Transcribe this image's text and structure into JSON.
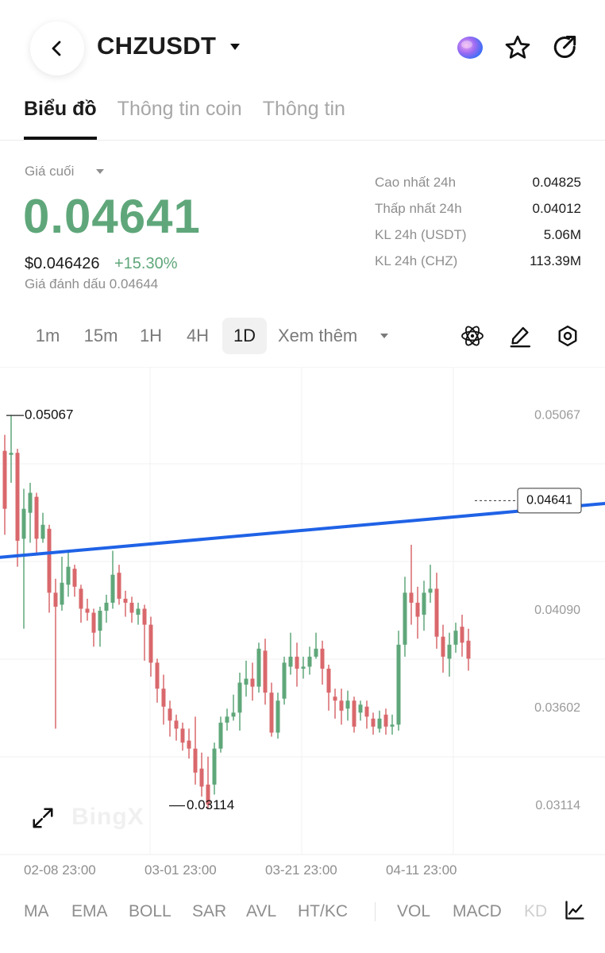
{
  "header": {
    "title": "CHZUSDT",
    "icons": [
      "back-icon",
      "caret-down-icon",
      "ai-orb-icon",
      "star-icon",
      "share-icon"
    ]
  },
  "tabs": [
    {
      "label": "Biểu đồ",
      "active": true
    },
    {
      "label": "Thông tin coin",
      "active": false
    },
    {
      "label": "Thông tin",
      "active": false
    }
  ],
  "price": {
    "label": "Giá cuối",
    "last": "0.04641",
    "usd": "$0.046426",
    "change": "+15.30%",
    "mark": "Giá đánh dấu 0.04644",
    "color_up": "#5fa77a"
  },
  "stats": [
    {
      "label": "Cao nhất 24h",
      "value": "0.04825"
    },
    {
      "label": "Thấp nhất 24h",
      "value": "0.04012"
    },
    {
      "label": "KL 24h (USDT)",
      "value": "5.06M"
    },
    {
      "label": "KL 24h (CHZ)",
      "value": "113.39M"
    }
  ],
  "timeframes": [
    {
      "label": "1m",
      "active": false
    },
    {
      "label": "15m",
      "active": false
    },
    {
      "label": "1H",
      "active": false
    },
    {
      "label": "4H",
      "active": false
    },
    {
      "label": "1D",
      "active": true
    }
  ],
  "more_label": "Xem thêm",
  "tools": [
    "atom-icon",
    "pencil-icon",
    "settings-icon"
  ],
  "watermark": "BingX",
  "chart_data": {
    "type": "candlestick",
    "y_ticks": [
      "0.05067",
      "0.04090",
      "0.03602",
      "0.03114"
    ],
    "x_labels": [
      "02-08 23:00",
      "03-01 23:00",
      "03-21 23:00",
      "04-11 23:00"
    ],
    "high_label": "0.05067",
    "low_label": "0.03114",
    "last_price_label": "0.04641",
    "ylim": [
      0.0287,
      0.0531
    ],
    "up_color": "#5fa77a",
    "down_color": "#d9686c",
    "trendline_color": "#1f62e6",
    "trendline": [
      [
        -0.5,
        0.04358
      ],
      [
        74.5,
        0.0457
      ]
    ],
    "candles": [
      [
        0.0489,
        0.046,
        0.0497,
        0.0447
      ],
      [
        0.0487,
        0.0488,
        0.0507,
        0.0473
      ],
      [
        0.0488,
        0.0444,
        0.049,
        0.0431
      ],
      [
        0.0445,
        0.046,
        0.047,
        0.04
      ],
      [
        0.0458,
        0.0468,
        0.0473,
        0.0443
      ],
      [
        0.0466,
        0.0445,
        0.0468,
        0.0437
      ],
      [
        0.0445,
        0.0452,
        0.0458,
        0.0443
      ],
      [
        0.045,
        0.0418,
        0.0452,
        0.0408
      ],
      [
        0.0418,
        0.0411,
        0.0425,
        0.035
      ],
      [
        0.0412,
        0.0423,
        0.0436,
        0.0409
      ],
      [
        0.0422,
        0.0431,
        0.0439,
        0.0416
      ],
      [
        0.043,
        0.0421,
        0.0432,
        0.0416
      ],
      [
        0.042,
        0.041,
        0.0422,
        0.0403
      ],
      [
        0.041,
        0.0408,
        0.0415,
        0.0404
      ],
      [
        0.0408,
        0.0398,
        0.041,
        0.0391
      ],
      [
        0.0399,
        0.0409,
        0.0411,
        0.0391
      ],
      [
        0.0409,
        0.0413,
        0.0417,
        0.0403
      ],
      [
        0.0413,
        0.0427,
        0.0439,
        0.041
      ],
      [
        0.0428,
        0.0415,
        0.0432,
        0.0412
      ],
      [
        0.0415,
        0.0413,
        0.0419,
        0.0406
      ],
      [
        0.0413,
        0.0408,
        0.0416,
        0.0403
      ],
      [
        0.0407,
        0.041,
        0.0413,
        0.0402
      ],
      [
        0.041,
        0.0402,
        0.0412,
        0.0384
      ],
      [
        0.0402,
        0.0383,
        0.0406,
        0.0376
      ],
      [
        0.0383,
        0.037,
        0.0385,
        0.0363
      ],
      [
        0.037,
        0.0361,
        0.0377,
        0.0352
      ],
      [
        0.036,
        0.0354,
        0.0364,
        0.0346
      ],
      [
        0.0354,
        0.035,
        0.0357,
        0.0344
      ],
      [
        0.035,
        0.0343,
        0.0353,
        0.0339
      ],
      [
        0.0344,
        0.034,
        0.035,
        0.0335
      ],
      [
        0.034,
        0.0328,
        0.0356,
        0.0322
      ],
      [
        0.033,
        0.0321,
        0.0338,
        0.0316
      ],
      [
        0.0322,
        0.0312,
        0.0336,
        0.031
      ],
      [
        0.0322,
        0.034,
        0.0343,
        0.0317
      ],
      [
        0.034,
        0.0353,
        0.0356,
        0.0338
      ],
      [
        0.0353,
        0.0356,
        0.036,
        0.0349
      ],
      [
        0.0356,
        0.0358,
        0.0367,
        0.0354
      ],
      [
        0.0358,
        0.0373,
        0.0378,
        0.0349
      ],
      [
        0.0372,
        0.0375,
        0.0384,
        0.0366
      ],
      [
        0.0375,
        0.0371,
        0.0383,
        0.0364
      ],
      [
        0.0371,
        0.039,
        0.0393,
        0.0368
      ],
      [
        0.0389,
        0.0368,
        0.0395,
        0.0362
      ],
      [
        0.0368,
        0.0348,
        0.0373,
        0.0346
      ],
      [
        0.0348,
        0.0364,
        0.0368,
        0.0345
      ],
      [
        0.0365,
        0.0383,
        0.0386,
        0.0362
      ],
      [
        0.0381,
        0.0386,
        0.0398,
        0.0377
      ],
      [
        0.0386,
        0.038,
        0.0393,
        0.0371
      ],
      [
        0.038,
        0.0381,
        0.0386,
        0.0375
      ],
      [
        0.0381,
        0.0386,
        0.0391,
        0.0377
      ],
      [
        0.0386,
        0.039,
        0.0398,
        0.0385
      ],
      [
        0.039,
        0.038,
        0.0394,
        0.0372
      ],
      [
        0.038,
        0.0368,
        0.0382,
        0.0359
      ],
      [
        0.0366,
        0.0364,
        0.037,
        0.0355
      ],
      [
        0.0364,
        0.0359,
        0.037,
        0.0352
      ],
      [
        0.036,
        0.0364,
        0.0369,
        0.0354
      ],
      [
        0.0364,
        0.0351,
        0.0366,
        0.0348
      ],
      [
        0.0358,
        0.0362,
        0.0364,
        0.0354
      ],
      [
        0.0361,
        0.0356,
        0.0364,
        0.035
      ],
      [
        0.0355,
        0.0351,
        0.0358,
        0.0347
      ],
      [
        0.035,
        0.0355,
        0.0359,
        0.0348
      ],
      [
        0.0357,
        0.0351,
        0.036,
        0.0347
      ],
      [
        0.0351,
        0.0352,
        0.0357,
        0.0347
      ],
      [
        0.0352,
        0.0392,
        0.0399,
        0.0349
      ],
      [
        0.0392,
        0.0418,
        0.0426,
        0.0386
      ],
      [
        0.0418,
        0.0413,
        0.0442,
        0.0402
      ],
      [
        0.0413,
        0.0406,
        0.0421,
        0.0395
      ],
      [
        0.0407,
        0.0418,
        0.0424,
        0.0399
      ],
      [
        0.0418,
        0.042,
        0.0432,
        0.0413
      ],
      [
        0.042,
        0.0396,
        0.0428,
        0.039
      ],
      [
        0.0396,
        0.0386,
        0.0402,
        0.0378
      ],
      [
        0.0385,
        0.0392,
        0.0398,
        0.0376
      ],
      [
        0.0392,
        0.0399,
        0.0403,
        0.0388
      ],
      [
        0.0401,
        0.0393,
        0.0407,
        0.0386
      ],
      [
        0.0394,
        0.0385,
        0.04,
        0.0379
      ]
    ]
  },
  "indicators": [
    {
      "label": "MA"
    },
    {
      "label": "EMA"
    },
    {
      "label": "BOLL"
    },
    {
      "label": "SAR"
    },
    {
      "label": "AVL"
    },
    {
      "label": "HT/KC"
    },
    {
      "label": "VOL"
    },
    {
      "label": "MACD"
    },
    {
      "label": "KD"
    }
  ]
}
